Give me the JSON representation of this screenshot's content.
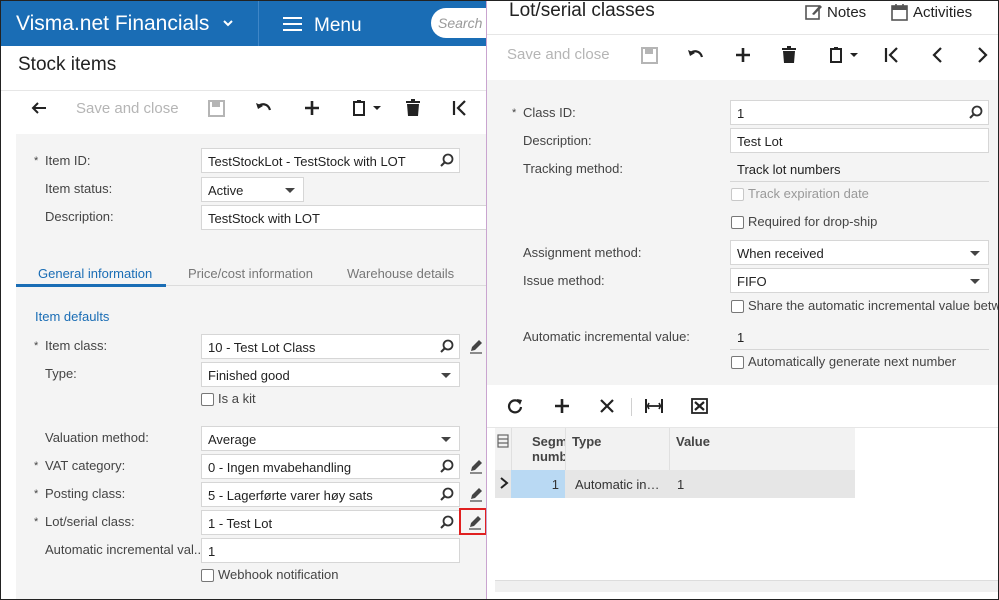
{
  "app": {
    "brand": "Visma.net Financials",
    "menu_label": "Menu",
    "search_placeholder": "Search"
  },
  "stock": {
    "title": "Stock items",
    "toolbar": {
      "save_close": "Save and close"
    },
    "fields": {
      "item_id": {
        "label": "Item ID:",
        "value": "TestStockLot - TestStock with LOT"
      },
      "item_status": {
        "label": "Item status:",
        "value": "Active"
      },
      "description": {
        "label": "Description:",
        "value": "TestStock with LOT"
      }
    },
    "tabs": [
      "General information",
      "Price/cost information",
      "Warehouse details"
    ],
    "section": "Item defaults",
    "defaults": {
      "item_class": {
        "label": "Item class:",
        "value": "10 - Test Lot Class"
      },
      "type": {
        "label": "Type:",
        "value": "Finished good"
      },
      "is_kit": "Is a kit",
      "valuation": {
        "label": "Valuation method:",
        "value": "Average"
      },
      "vat": {
        "label": "VAT category:",
        "value": "0 - Ingen mvabehandling"
      },
      "posting": {
        "label": "Posting class:",
        "value": "5 - Lagerførte varer høy sats"
      },
      "lot": {
        "label": "Lot/serial class:",
        "value": "1 - Test Lot"
      },
      "auto_inc": {
        "label": "Automatic incremental val...",
        "value": "1"
      },
      "webhook": "Webhook notification"
    }
  },
  "lot": {
    "title": "Lot/serial classes",
    "notes": "Notes",
    "activities": "Activities",
    "toolbar": {
      "save_close": "Save and close"
    },
    "class_id": {
      "label": "Class ID:",
      "value": "1"
    },
    "description": {
      "label": "Description:",
      "value": "Test Lot"
    },
    "tracking": {
      "label": "Tracking method:",
      "value": "Track lot numbers"
    },
    "track_exp": "Track expiration date",
    "req_dropship": "Required for drop-ship",
    "assignment": {
      "label": "Assignment method:",
      "value": "When received"
    },
    "issue": {
      "label": "Issue method:",
      "value": "FIFO"
    },
    "share_auto": "Share the automatic incremental value betwe",
    "auto_inc": {
      "label": "Automatic incremental value:",
      "value": "1"
    },
    "auto_gen": "Automatically generate next number",
    "grid": {
      "headers": [
        "Segm numb",
        "Type",
        "Value"
      ],
      "rows": [
        {
          "segment": "1",
          "type": "Automatic in…",
          "value": "1"
        }
      ]
    }
  }
}
